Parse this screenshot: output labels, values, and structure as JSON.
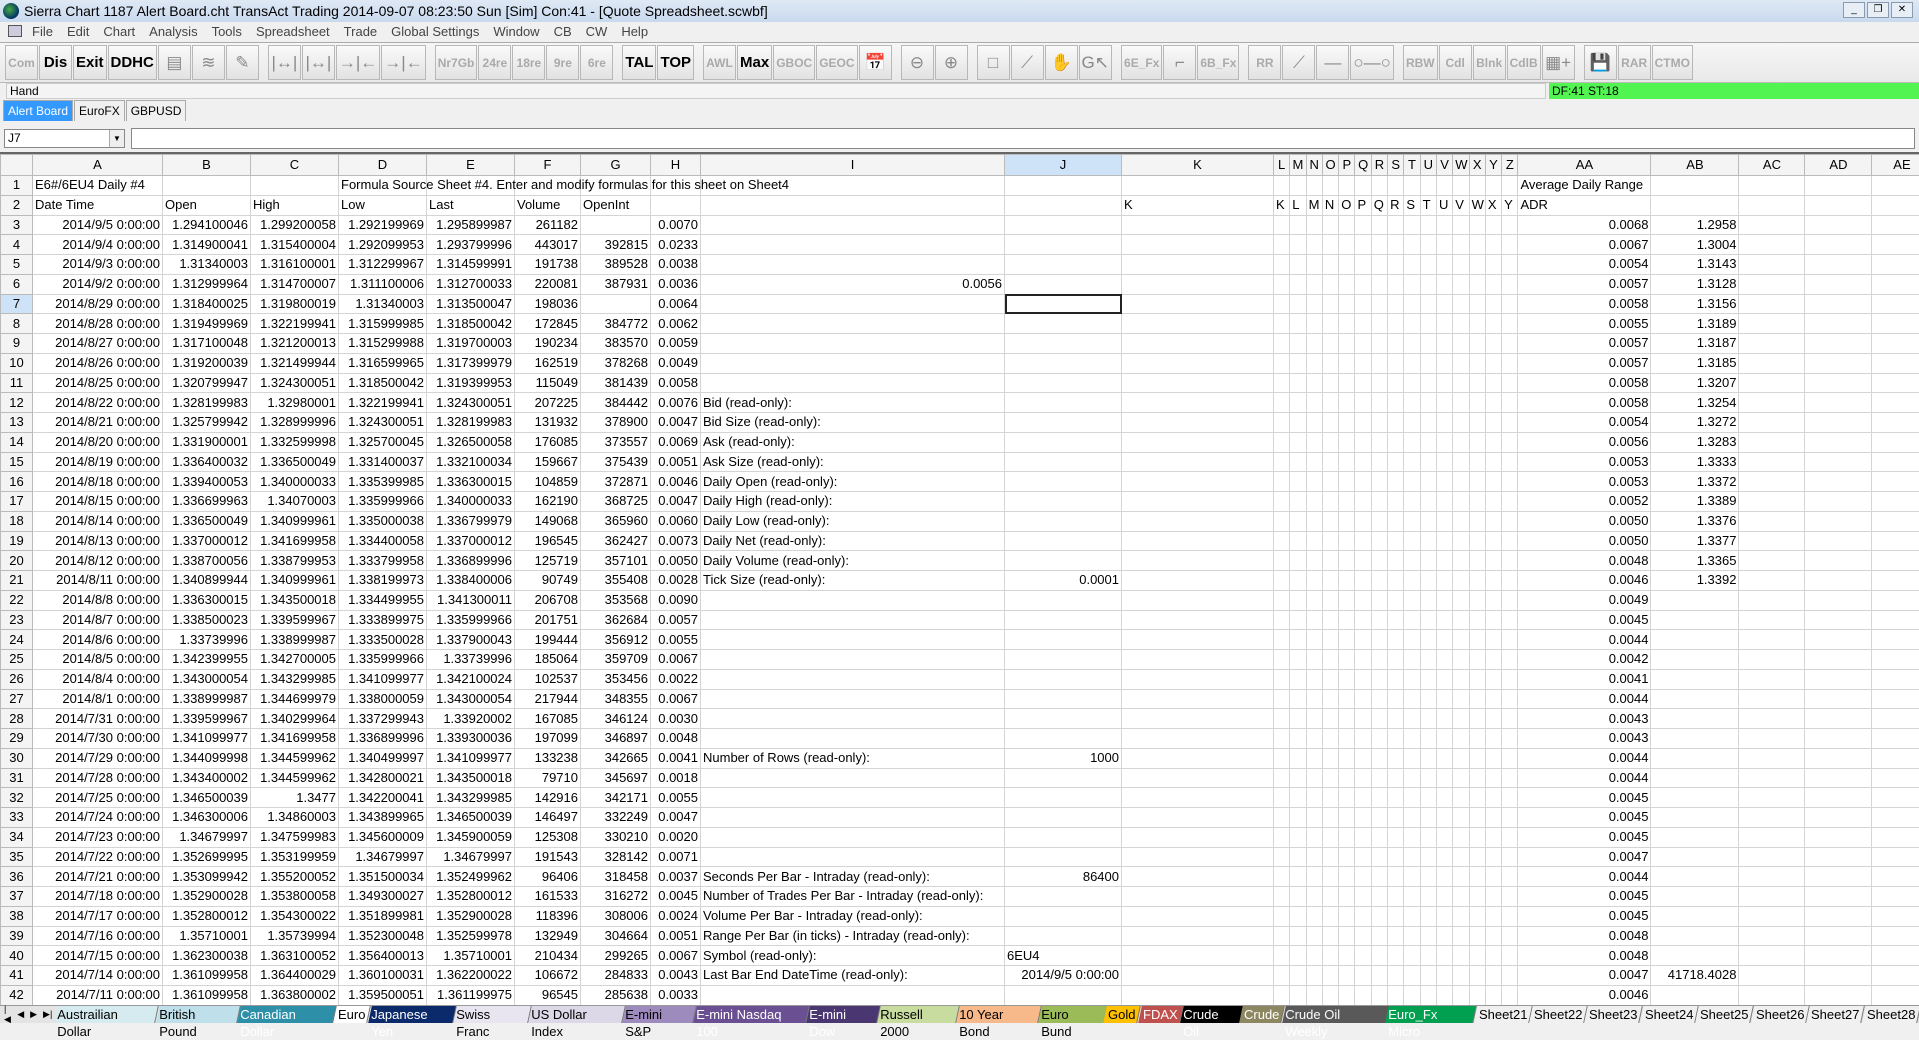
{
  "window": {
    "title": "Sierra Chart 1187 Alert Board.cht  TransAct Trading 2014-09-07  08:23:50 Sun [Sim]  Con:41 - [Quote Spreadsheet.scwbf]"
  },
  "menu": [
    "File",
    "Edit",
    "Chart",
    "Analysis",
    "Tools",
    "Spreadsheet",
    "Trade",
    "Global Settings",
    "Window",
    "CB",
    "CW",
    "Help"
  ],
  "toolbar": [
    {
      "label": "Com"
    },
    {
      "label": "Dis",
      "on": true
    },
    {
      "label": "Exit",
      "on": true
    },
    {
      "label": "DDHC",
      "on": true
    },
    {
      "icon": "chart-settings-icon",
      "glyph": "▤"
    },
    {
      "icon": "arcs-icon",
      "glyph": "≋"
    },
    {
      "icon": "text-tools-icon",
      "glyph": "✎"
    },
    {
      "gap": true
    },
    {
      "icon": "bracket-left-icon",
      "glyph": "|↔|"
    },
    {
      "icon": "bracket-right-icon",
      "glyph": "|↔|"
    },
    {
      "icon": "compress-left-icon",
      "glyph": "→|←"
    },
    {
      "icon": "compress-right-icon",
      "glyph": "→|←"
    },
    {
      "gap": true
    },
    {
      "label": "Nr7Gb"
    },
    {
      "label": "24re"
    },
    {
      "label": "18re"
    },
    {
      "label": "9re"
    },
    {
      "label": "6re"
    },
    {
      "gap": true
    },
    {
      "label": "TAL",
      "on": true
    },
    {
      "label": "TOP",
      "on": true
    },
    {
      "gap": true
    },
    {
      "label": "AWL"
    },
    {
      "label": "Max",
      "on": true
    },
    {
      "label": "GBOC"
    },
    {
      "label": "GEOC"
    },
    {
      "icon": "calendar-icon",
      "glyph": "📅"
    },
    {
      "gap": true
    },
    {
      "icon": "zoom-out-icon",
      "glyph": "⊖"
    },
    {
      "icon": "zoom-in-icon",
      "glyph": "⊕"
    },
    {
      "gap": true
    },
    {
      "icon": "rectangle-icon",
      "glyph": "□"
    },
    {
      "icon": "draw-line-icon",
      "glyph": "⟋"
    },
    {
      "icon": "hand-icon",
      "glyph": "✋"
    },
    {
      "icon": "cursor-icon",
      "glyph": "G↖"
    },
    {
      "gap": true
    },
    {
      "label": "6E_Fx"
    },
    {
      "icon": "chart-line-icon",
      "glyph": "⌐"
    },
    {
      "label": "6B_Fx"
    },
    {
      "gap": true
    },
    {
      "label": "RR"
    },
    {
      "icon": "ray-icon",
      "glyph": "⟋"
    },
    {
      "icon": "horizontal-line-icon",
      "glyph": "—"
    },
    {
      "icon": "segment-icon",
      "glyph": "○—○"
    },
    {
      "gap": true
    },
    {
      "label": "RBW"
    },
    {
      "label": "Cdl"
    },
    {
      "label": "Blnk"
    },
    {
      "label": "CdlB"
    },
    {
      "icon": "grid-add-icon",
      "glyph": "▦+"
    },
    {
      "gap": true
    },
    {
      "icon": "save-icon",
      "glyph": "💾"
    },
    {
      "label": "RAR"
    },
    {
      "label": "CTMO"
    }
  ],
  "status": {
    "tool": "Hand",
    "df": "DF:41  ST:18"
  },
  "chart_tabs": [
    {
      "label": "Alert Board",
      "active": true
    },
    {
      "label": "EuroFX"
    },
    {
      "label": "GBPUSD"
    }
  ],
  "formula_bar": {
    "cell_ref": "J7",
    "formula": ""
  },
  "grid": {
    "columns": [
      "A",
      "B",
      "C",
      "D",
      "E",
      "F",
      "G",
      "H",
      "I",
      "J",
      "K",
      "L",
      "M",
      "N",
      "O",
      "P",
      "Q",
      "R",
      "S",
      "T",
      "U",
      "V",
      "W",
      "X",
      "Y",
      "Z",
      "AA",
      "AB",
      "AC",
      "AD",
      "AE"
    ],
    "selected_cell": "J7",
    "row1": {
      "A": "E6#/6EU4  Daily  #4",
      "D": "Formula Source Sheet #4.  Enter and modify formulas for this sheet on Sheet4",
      "AA": "Average Daily Range"
    },
    "row2": {
      "A": "Date Time",
      "B": "Open",
      "C": "High",
      "D": "Low",
      "E": "Last",
      "F": "Volume",
      "G": "OpenInt",
      "K": "K",
      "L": "K",
      "M": "L",
      "N": "M",
      "O": "N",
      "P": "O",
      "Q": "P",
      "R": "Q",
      "S": "R",
      "T": "S",
      "U": "T",
      "V": "U",
      "W": "V",
      "X": "W",
      "Y": "X",
      "Z": "Y",
      "AA": "ADR"
    },
    "data_columns": [
      "A",
      "B",
      "C",
      "D",
      "E",
      "F",
      "G",
      "H",
      "I",
      "J",
      "AA",
      "AB"
    ],
    "rows": [
      [
        "2014/9/5 0:00:00",
        "1.294100046",
        "1.299200058",
        "1.292199969",
        "1.295899987",
        "261182",
        "",
        "0.0070",
        "",
        "",
        "0.0068",
        "1.2958"
      ],
      [
        "2014/9/4 0:00:00",
        "1.314900041",
        "1.315400004",
        "1.292099953",
        "1.293799996",
        "443017",
        "392815",
        "0.0233",
        "",
        "",
        "0.0067",
        "1.3004"
      ],
      [
        "2014/9/3 0:00:00",
        "1.31340003",
        "1.316100001",
        "1.312299967",
        "1.314599991",
        "191738",
        "389528",
        "0.0038",
        "",
        "",
        "0.0054",
        "1.3143"
      ],
      [
        "2014/9/2 0:00:00",
        "1.312999964",
        "1.314700007",
        "1.311100006",
        "1.312700033",
        "220081",
        "387931",
        "0.0036",
        "0.0056",
        "",
        "0.0057",
        "1.3128"
      ],
      [
        "2014/8/29 0:00:00",
        "1.318400025",
        "1.319800019",
        "1.31340003",
        "1.313500047",
        "198036",
        "",
        "0.0064",
        "",
        "",
        "0.0058",
        "1.3156"
      ],
      [
        "2014/8/28 0:00:00",
        "1.319499969",
        "1.322199941",
        "1.315999985",
        "1.318500042",
        "172845",
        "384772",
        "0.0062",
        "",
        "",
        "0.0055",
        "1.3189"
      ],
      [
        "2014/8/27 0:00:00",
        "1.317100048",
        "1.321200013",
        "1.315299988",
        "1.319700003",
        "190234",
        "383570",
        "0.0059",
        "",
        "",
        "0.0057",
        "1.3187"
      ],
      [
        "2014/8/26 0:00:00",
        "1.319200039",
        "1.321499944",
        "1.316599965",
        "1.317399979",
        "162519",
        "378268",
        "0.0049",
        "",
        "",
        "0.0057",
        "1.3185"
      ],
      [
        "2014/8/25 0:00:00",
        "1.320799947",
        "1.324300051",
        "1.318500042",
        "1.319399953",
        "115049",
        "381439",
        "0.0058",
        "",
        "",
        "0.0058",
        "1.3207"
      ],
      [
        "2014/8/22 0:00:00",
        "1.328199983",
        "1.32980001",
        "1.322199941",
        "1.324300051",
        "207225",
        "384442",
        "0.0076",
        "Bid (read-only):",
        "",
        "0.0058",
        "1.3254"
      ],
      [
        "2014/8/21 0:00:00",
        "1.325799942",
        "1.328999996",
        "1.324300051",
        "1.328199983",
        "131932",
        "378900",
        "0.0047",
        "Bid Size (read-only):",
        "",
        "0.0054",
        "1.3272"
      ],
      [
        "2014/8/20 0:00:00",
        "1.331900001",
        "1.332599998",
        "1.325700045",
        "1.326500058",
        "176085",
        "373557",
        "0.0069",
        "Ask (read-only):",
        "",
        "0.0056",
        "1.3283"
      ],
      [
        "2014/8/19 0:00:00",
        "1.336400032",
        "1.336500049",
        "1.331400037",
        "1.332100034",
        "159667",
        "375439",
        "0.0051",
        "Ask Size (read-only):",
        "",
        "0.0053",
        "1.3333"
      ],
      [
        "2014/8/18 0:00:00",
        "1.339400053",
        "1.340000033",
        "1.335399985",
        "1.336300015",
        "104859",
        "372871",
        "0.0046",
        "Daily Open (read-only):",
        "",
        "0.0053",
        "1.3372"
      ],
      [
        "2014/8/15 0:00:00",
        "1.336699963",
        "1.34070003",
        "1.335999966",
        "1.340000033",
        "162190",
        "368725",
        "0.0047",
        "Daily High (read-only):",
        "",
        "0.0052",
        "1.3389"
      ],
      [
        "2014/8/14 0:00:00",
        "1.336500049",
        "1.340999961",
        "1.335000038",
        "1.336799979",
        "149068",
        "365960",
        "0.0060",
        "Daily Low (read-only):",
        "",
        "0.0050",
        "1.3376"
      ],
      [
        "2014/8/13 0:00:00",
        "1.337000012",
        "1.341699958",
        "1.334400058",
        "1.337000012",
        "196545",
        "362427",
        "0.0073",
        "Daily Net (read-only):",
        "",
        "0.0050",
        "1.3377"
      ],
      [
        "2014/8/12 0:00:00",
        "1.338700056",
        "1.338799953",
        "1.333799958",
        "1.336899996",
        "125719",
        "357101",
        "0.0050",
        "Daily Volume (read-only):",
        "",
        "0.0048",
        "1.3365"
      ],
      [
        "2014/8/11 0:00:00",
        "1.340899944",
        "1.340999961",
        "1.338199973",
        "1.338400006",
        "90749",
        "355408",
        "0.0028",
        "Tick Size (read-only):",
        "0.0001",
        "0.0046",
        "1.3392"
      ],
      [
        "2014/8/8 0:00:00",
        "1.336300015",
        "1.343500018",
        "1.334499955",
        "1.341300011",
        "206708",
        "353568",
        "0.0090",
        "",
        "",
        "0.0049",
        ""
      ],
      [
        "2014/8/7 0:00:00",
        "1.338500023",
        "1.339599967",
        "1.333899975",
        "1.335999966",
        "201751",
        "362684",
        "0.0057",
        "",
        "",
        "0.0045",
        ""
      ],
      [
        "2014/8/6 0:00:00",
        "1.33739996",
        "1.338999987",
        "1.333500028",
        "1.337900043",
        "199444",
        "356912",
        "0.0055",
        "",
        "",
        "0.0044",
        ""
      ],
      [
        "2014/8/5 0:00:00",
        "1.342399955",
        "1.342700005",
        "1.335999966",
        "1.33739996",
        "185064",
        "359709",
        "0.0067",
        "",
        "",
        "0.0042",
        ""
      ],
      [
        "2014/8/4 0:00:00",
        "1.343000054",
        "1.343299985",
        "1.341099977",
        "1.342100024",
        "102537",
        "353456",
        "0.0022",
        "",
        "",
        "0.0041",
        ""
      ],
      [
        "2014/8/1 0:00:00",
        "1.338999987",
        "1.344699979",
        "1.338000059",
        "1.343000054",
        "217944",
        "348355",
        "0.0067",
        "",
        "",
        "0.0044",
        ""
      ],
      [
        "2014/7/31 0:00:00",
        "1.339599967",
        "1.340299964",
        "1.337299943",
        "1.33920002",
        "167085",
        "346124",
        "0.0030",
        "",
        "",
        "0.0043",
        ""
      ],
      [
        "2014/7/30 0:00:00",
        "1.341099977",
        "1.341699958",
        "1.336899996",
        "1.339300036",
        "197099",
        "346897",
        "0.0048",
        "",
        "",
        "0.0043",
        ""
      ],
      [
        "2014/7/29 0:00:00",
        "1.344099998",
        "1.344599962",
        "1.340499997",
        "1.341099977",
        "133238",
        "342665",
        "0.0041",
        "Number of Rows (read-only):",
        "1000",
        "0.0044",
        ""
      ],
      [
        "2014/7/28 0:00:00",
        "1.343400002",
        "1.344599962",
        "1.342800021",
        "1.343500018",
        "79710",
        "345697",
        "0.0018",
        "",
        "",
        "0.0044",
        ""
      ],
      [
        "2014/7/25 0:00:00",
        "1.346500039",
        "1.3477",
        "1.342200041",
        "1.343299985",
        "142916",
        "342171",
        "0.0055",
        "",
        "",
        "0.0045",
        ""
      ],
      [
        "2014/7/24 0:00:00",
        "1.346300006",
        "1.34860003",
        "1.343899965",
        "1.346500039",
        "146497",
        "332249",
        "0.0047",
        "",
        "",
        "0.0045",
        ""
      ],
      [
        "2014/7/23 0:00:00",
        "1.34679997",
        "1.347599983",
        "1.345600009",
        "1.345900059",
        "125308",
        "330210",
        "0.0020",
        "",
        "",
        "0.0045",
        ""
      ],
      [
        "2014/7/22 0:00:00",
        "1.352699995",
        "1.353199959",
        "1.34679997",
        "1.34679997",
        "191543",
        "328142",
        "0.0071",
        "",
        "",
        "0.0047",
        ""
      ],
      [
        "2014/7/21 0:00:00",
        "1.353099942",
        "1.355200052",
        "1.351500034",
        "1.352499962",
        "96406",
        "318458",
        "0.0037",
        "Seconds Per Bar - Intraday (read-only):",
        "86400",
        "0.0044",
        ""
      ],
      [
        "2014/7/18 0:00:00",
        "1.352900028",
        "1.353800058",
        "1.349300027",
        "1.352800012",
        "161533",
        "316272",
        "0.0045",
        "Number of Trades Per Bar - Intraday (read-only):",
        "",
        "0.0045",
        ""
      ],
      [
        "2014/7/17 0:00:00",
        "1.352800012",
        "1.354300022",
        "1.351899981",
        "1.352900028",
        "118396",
        "308006",
        "0.0024",
        "Volume Per Bar - Intraday (read-only):",
        "",
        "0.0045",
        ""
      ],
      [
        "2014/7/16 0:00:00",
        "1.35710001",
        "1.35739994",
        "1.352300048",
        "1.352599978",
        "132949",
        "304664",
        "0.0051",
        "Range Per Bar (in ticks) - Intraday (read-only):",
        "",
        "0.0048",
        ""
      ],
      [
        "2014/7/15 0:00:00",
        "1.362300038",
        "1.363100052",
        "1.356400013",
        "1.35710001",
        "210434",
        "299265",
        "0.0067",
        "Symbol (read-only):",
        "6EU4",
        "0.0048",
        ""
      ],
      [
        "2014/7/14 0:00:00",
        "1.361099958",
        "1.364400029",
        "1.360100031",
        "1.362200022",
        "106672",
        "284833",
        "0.0043",
        "Last Bar End DateTime (read-only):",
        "2014/9/5 0:00:00",
        "0.0047",
        "41718.4028"
      ],
      [
        "2014/7/11 0:00:00",
        "1.361099958",
        "1.363800002",
        "1.359500051",
        "1.361199975",
        "96545",
        "285638",
        "0.0033",
        "",
        "",
        "0.0046",
        ""
      ]
    ]
  },
  "sheet_tabs": [
    {
      "label": "Austrailian Dollar",
      "bg": "#d6ebef",
      "fg": "#000"
    },
    {
      "label": "British Pound",
      "bg": "#bfe0ea",
      "fg": "#000"
    },
    {
      "label": "Canadian Dollar",
      "bg": "#2e8fa8",
      "fg": "#fff"
    },
    {
      "label": "Euro",
      "bg": "#ffffff",
      "fg": "#000"
    },
    {
      "label": "Japanese Yen",
      "bg": "#0b2a6b",
      "fg": "#fff"
    },
    {
      "label": "Swiss Franc",
      "bg": "#e8e4f0",
      "fg": "#000"
    },
    {
      "label": "US Dollar Index",
      "bg": "#dcd8e8",
      "fg": "#000"
    },
    {
      "label": "E-mini S&P",
      "bg": "#9e8bbd",
      "fg": "#000"
    },
    {
      "label": "E-mini Nasdaq 100",
      "bg": "#6a4f92",
      "fg": "#fff"
    },
    {
      "label": "E-mini Dow",
      "bg": "#4a3670",
      "fg": "#fff"
    },
    {
      "label": "Russell 2000",
      "bg": "#c8dca0",
      "fg": "#000"
    },
    {
      "label": "10 Year Bond",
      "bg": "#f7b88a",
      "fg": "#000"
    },
    {
      "label": "Euro Bund",
      "bg": "#9bbb59",
      "fg": "#000"
    },
    {
      "label": "Gold",
      "bg": "#ffc000",
      "fg": "#000"
    },
    {
      "label": "FDAX",
      "bg": "#c0504d",
      "fg": "#fff"
    },
    {
      "label": "Crude Oil",
      "bg": "#000000",
      "fg": "#fff"
    },
    {
      "label": "Crude",
      "bg": "#8c8760",
      "fg": "#fff"
    },
    {
      "label": "Crude Oil Weekly",
      "bg": "#595959",
      "fg": "#fff"
    },
    {
      "label": "Euro_Fx Micro",
      "bg": "#00a050",
      "fg": "#fff"
    },
    {
      "label": "Sheet21",
      "bg": "#f0f0f0",
      "fg": "#000"
    },
    {
      "label": "Sheet22",
      "bg": "#f0f0f0",
      "fg": "#000"
    },
    {
      "label": "Sheet23",
      "bg": "#f0f0f0",
      "fg": "#000"
    },
    {
      "label": "Sheet24",
      "bg": "#f0f0f0",
      "fg": "#000"
    },
    {
      "label": "Sheet25",
      "bg": "#f0f0f0",
      "fg": "#000"
    },
    {
      "label": "Sheet26",
      "bg": "#f0f0f0",
      "fg": "#000"
    },
    {
      "label": "Sheet27",
      "bg": "#f0f0f0",
      "fg": "#000"
    },
    {
      "label": "Sheet28",
      "bg": "#f0f0f0",
      "fg": "#000"
    }
  ]
}
